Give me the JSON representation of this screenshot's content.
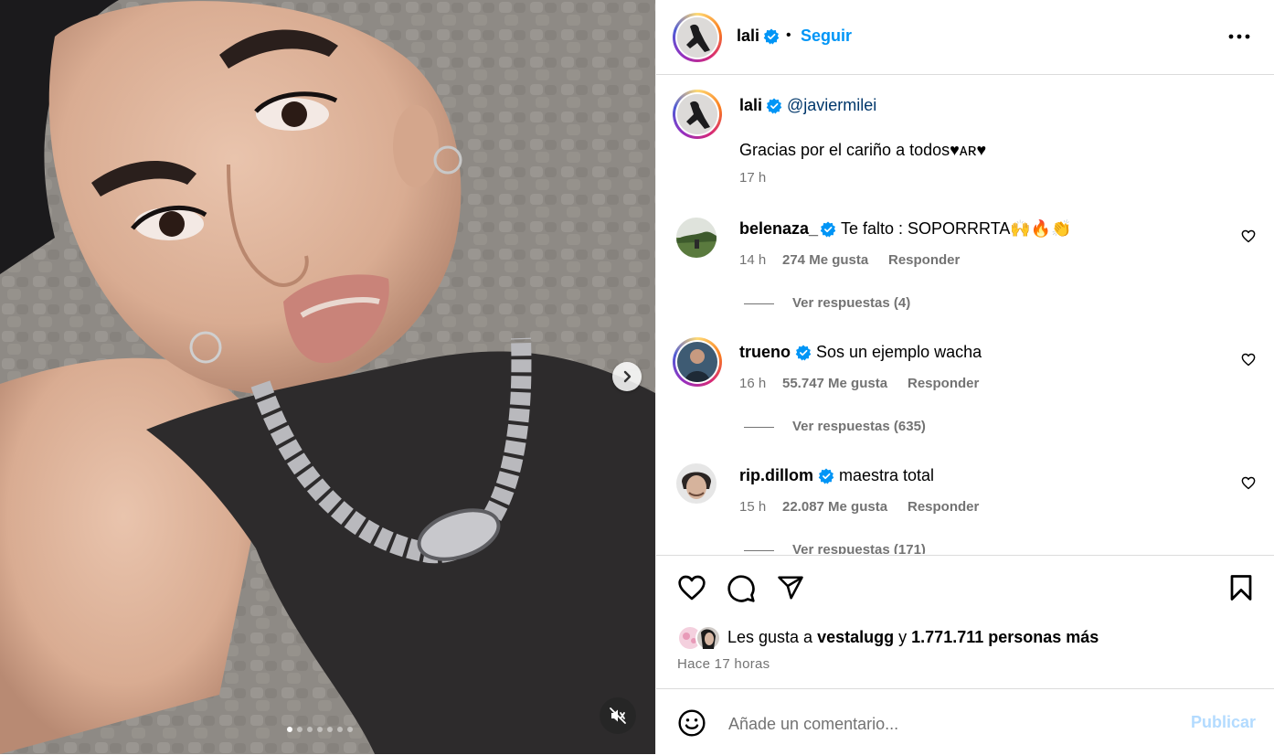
{
  "post": {
    "author": "lali",
    "follow_label": "Seguir",
    "separator": "•",
    "more_label": "..."
  },
  "caption": {
    "username": "lali",
    "mention": "@javiermilei",
    "text": "Gracias por el cariño a todos♥ᴀʀ♥",
    "time": "17 h"
  },
  "comments": [
    {
      "username": "belenaza_",
      "text": "Te falto : SOPORRRTA🙌🔥👏",
      "time": "14 h",
      "likes": "274 Me gusta",
      "reply": "Responder",
      "replies": "Ver respuestas (4)"
    },
    {
      "username": "trueno",
      "text": "Sos un ejemplo wacha",
      "time": "16 h",
      "likes": "55.747 Me gusta",
      "reply": "Responder",
      "replies": "Ver respuestas (635)"
    },
    {
      "username": "rip.dillom",
      "text": "maestra total",
      "time": "15 h",
      "likes": "22.087 Me gusta",
      "reply": "Responder",
      "replies": "Ver respuestas (171)"
    }
  ],
  "likes_line": {
    "prefix": "Les gusta a",
    "user": "vestalugg",
    "conj": "y",
    "others": "1.771.711 personas más"
  },
  "posted_time": "Hace 17 horas",
  "composer": {
    "placeholder": "Añade un comentario...",
    "publish_label": "Publicar"
  },
  "carousel": {
    "total_slides": 7,
    "active_slide": 1
  },
  "colors": {
    "accent": "#0095f6",
    "verified": "#0095f6",
    "muted": "#737373"
  }
}
